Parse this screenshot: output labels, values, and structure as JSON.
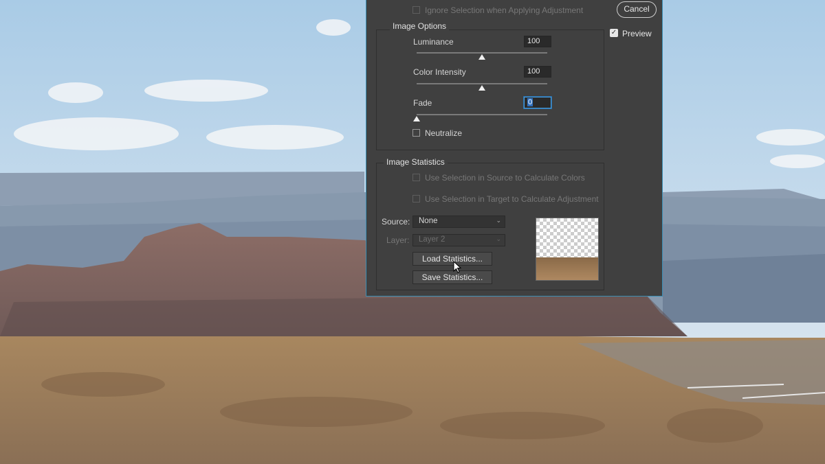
{
  "dialog": {
    "ignore_selection_label": "Ignore Selection when Applying Adjustment",
    "image_options": {
      "title": "Image Options",
      "luminance": {
        "label": "Luminance",
        "value": "100",
        "slider_level": 0.5
      },
      "color_intensity": {
        "label": "Color Intensity",
        "value": "100",
        "slider_level": 0.5
      },
      "fade": {
        "label": "Fade",
        "value": "0",
        "slider_level": 0.0
      },
      "neutralize_label": "Neutralize"
    },
    "image_statistics": {
      "title": "Image Statistics",
      "use_selection_source_label": "Use Selection in Source to Calculate Colors",
      "use_selection_target_label": "Use Selection in Target to Calculate Adjustment",
      "source_label": "Source:",
      "source_value": "None",
      "layer_label": "Layer:",
      "layer_value": "Layer 2",
      "load_button": "Load Statistics...",
      "save_button": "Save Statistics..."
    }
  },
  "side": {
    "cancel_button": "Cancel",
    "preview_label": "Preview",
    "preview_checked": true
  },
  "colors": {
    "dialog_bg": "#404040",
    "dialog_border": "#3a8fb5",
    "focus_blue": "#4a9fe0"
  },
  "icons": [
    "chevron-down-icon",
    "cursor-arrow-icon",
    "checkmark-icon"
  ]
}
